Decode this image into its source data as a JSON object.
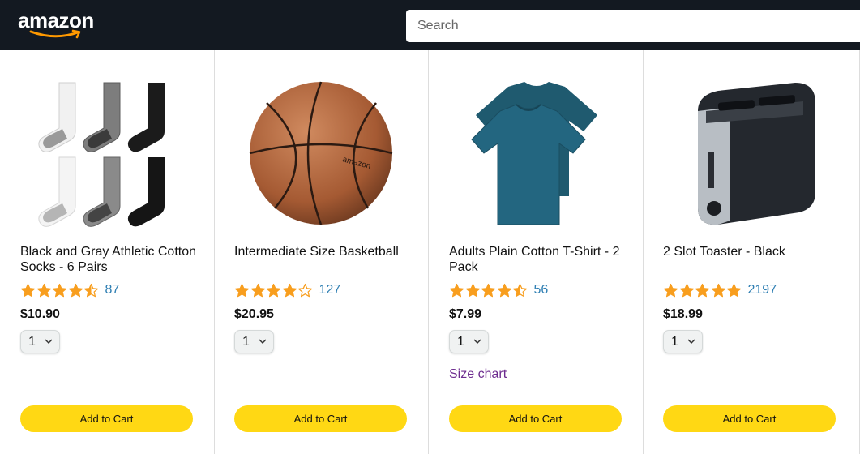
{
  "header": {
    "logo_text": "amazon",
    "search_placeholder": "Search"
  },
  "products": [
    {
      "name": "Black and Gray Athletic Cotton Socks - 6 Pairs",
      "rating": 4.5,
      "rating_count": "87",
      "price": "$10.90",
      "quantity": "1",
      "add_to_cart": "Add to Cart",
      "image_icon": "socks-image"
    },
    {
      "name": "Intermediate Size Basketball",
      "rating": 4.0,
      "rating_count": "127",
      "price": "$20.95",
      "quantity": "1",
      "add_to_cart": "Add to Cart",
      "image_icon": "basketball-image"
    },
    {
      "name": "Adults Plain Cotton T-Shirt - 2 Pack",
      "rating": 4.5,
      "rating_count": "56",
      "price": "$7.99",
      "quantity": "1",
      "size_chart_link": "Size chart",
      "add_to_cart": "Add to Cart",
      "image_icon": "tshirt-image"
    },
    {
      "name": "2 Slot Toaster - Black",
      "rating": 5.0,
      "rating_count": "2197",
      "price": "$18.99",
      "quantity": "1",
      "add_to_cart": "Add to Cart",
      "image_icon": "toaster-image"
    }
  ],
  "colors": {
    "header_bg": "#131921",
    "star": "#f89e1e",
    "rating_count": "#2f7fb3",
    "cart_button": "#ffd814",
    "link_visited": "#6d2c8f"
  }
}
